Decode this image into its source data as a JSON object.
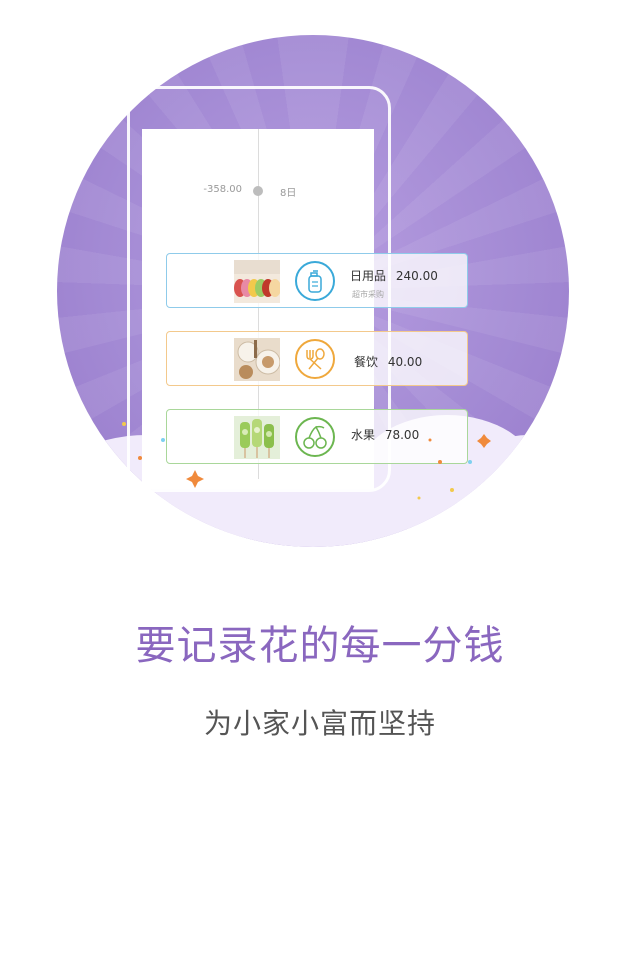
{
  "timeline": {
    "amount": "-358.00",
    "day": "8日"
  },
  "entries": [
    {
      "category": "日用品",
      "amount": "240.00",
      "note": "超市采购",
      "icon": "lotion-bottle-icon",
      "color": "#3aa9d9",
      "photo": "macarons"
    },
    {
      "category": "餐饮",
      "amount": "40.00",
      "icon": "fork-spoon-icon",
      "color": "#efa83c",
      "photo": "food-platter"
    },
    {
      "category": "水果",
      "amount": "78.00",
      "icon": "cherry-icon",
      "color": "#6cb650",
      "photo": "kiwi-popsicles"
    }
  ],
  "headline": "要记录花的每一分钱",
  "tagline": "为小家小富而坚持",
  "colors": {
    "circle": "#a38ad4",
    "headline": "#8a67bf",
    "tagline": "#555555",
    "cloud": "#f1ebfb"
  }
}
